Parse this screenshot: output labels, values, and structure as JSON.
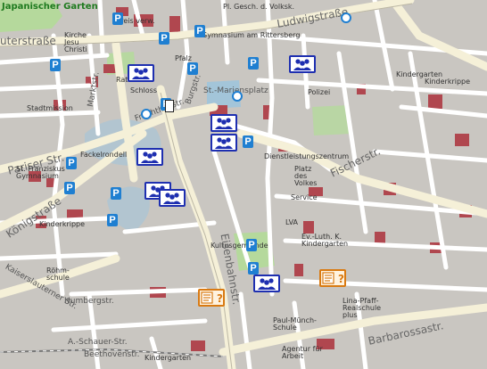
{
  "map": {
    "colors": {
      "block": "#c9c6c1",
      "street": "#ffffff",
      "main_road": "#f5f0d8",
      "green": "#b5d99c",
      "water": "#9fc4dc",
      "building_red": "#b0474f",
      "parking": "#1f7fd1",
      "group_marker": "#1e2fb0",
      "info_marker": "#d97a12"
    },
    "labels": [
      {
        "text": "Japanischer Garten",
        "kind": "garden"
      },
      {
        "text": "uterstraße",
        "kind": "street-big"
      },
      {
        "text": "Kirche Jesu Christi",
        "kind": "place"
      },
      {
        "text": "Kreis verw.",
        "kind": "place"
      },
      {
        "text": "Pl. Gesch. d. Volksk.",
        "kind": "place"
      },
      {
        "text": "Ludwigstraße",
        "kind": "street-big"
      },
      {
        "text": "Gymnasium am Rittersberg",
        "kind": "place"
      },
      {
        "text": "Burgstr.",
        "kind": "street"
      },
      {
        "text": "Rathaus",
        "kind": "place"
      },
      {
        "text": "Schloss",
        "kind": "place"
      },
      {
        "text": "Pfalz",
        "kind": "place"
      },
      {
        "text": "Polizei",
        "kind": "place"
      },
      {
        "text": "Kindergarten",
        "kind": "place"
      },
      {
        "text": "Fruchthallstr.",
        "kind": "street"
      },
      {
        "text": "Marktstr.",
        "kind": "street"
      },
      {
        "text": "St.-Mariensplatz",
        "kind": "street"
      },
      {
        "text": "Pariser Str.",
        "kind": "street-big"
      },
      {
        "text": "St. Franziskus Gymnasium",
        "kind": "place"
      },
      {
        "text": "Königstraße",
        "kind": "street-big"
      },
      {
        "text": "Kinderkrippe",
        "kind": "place"
      },
      {
        "text": "Fackelrondell",
        "kind": "place"
      },
      {
        "text": "Dienstleistungszentrum",
        "kind": "place"
      },
      {
        "text": "Platz des Volkes",
        "kind": "place"
      },
      {
        "text": "Fischerstr.",
        "kind": "street-big"
      },
      {
        "text": "Service",
        "kind": "place"
      },
      {
        "text": "Kultusgemeinde",
        "kind": "place"
      },
      {
        "text": "LVA",
        "kind": "place"
      },
      {
        "text": "Ev.-Luth. K. Kindergarten",
        "kind": "place"
      },
      {
        "text": "Röhm-schule",
        "kind": "place"
      },
      {
        "text": "Eisenbahnstr.",
        "kind": "street-big"
      },
      {
        "text": "Kaiserslauterner Str.",
        "kind": "street"
      },
      {
        "text": "Lina-Pfaff-Realschule plus",
        "kind": "place"
      },
      {
        "text": "Paul-Münch-Schule",
        "kind": "place"
      },
      {
        "text": "Agentur für Arbeit",
        "kind": "place"
      },
      {
        "text": "Barbarossastr.",
        "kind": "street-big"
      },
      {
        "text": "Kindergarten",
        "kind": "place"
      },
      {
        "text": "Beethovenstr.",
        "kind": "street"
      },
      {
        "text": "A.-Schauer-Str.",
        "kind": "street"
      },
      {
        "text": "Humbergstr.",
        "kind": "street"
      },
      {
        "text": "Stadtmission",
        "kind": "place"
      },
      {
        "text": "Kinderkrippe",
        "kind": "place"
      }
    ],
    "markers": {
      "parking_icon": "parking-icon",
      "group_icon": "group-people-icon",
      "info_icon": "info-question-icon",
      "parking_letter": "P"
    }
  }
}
